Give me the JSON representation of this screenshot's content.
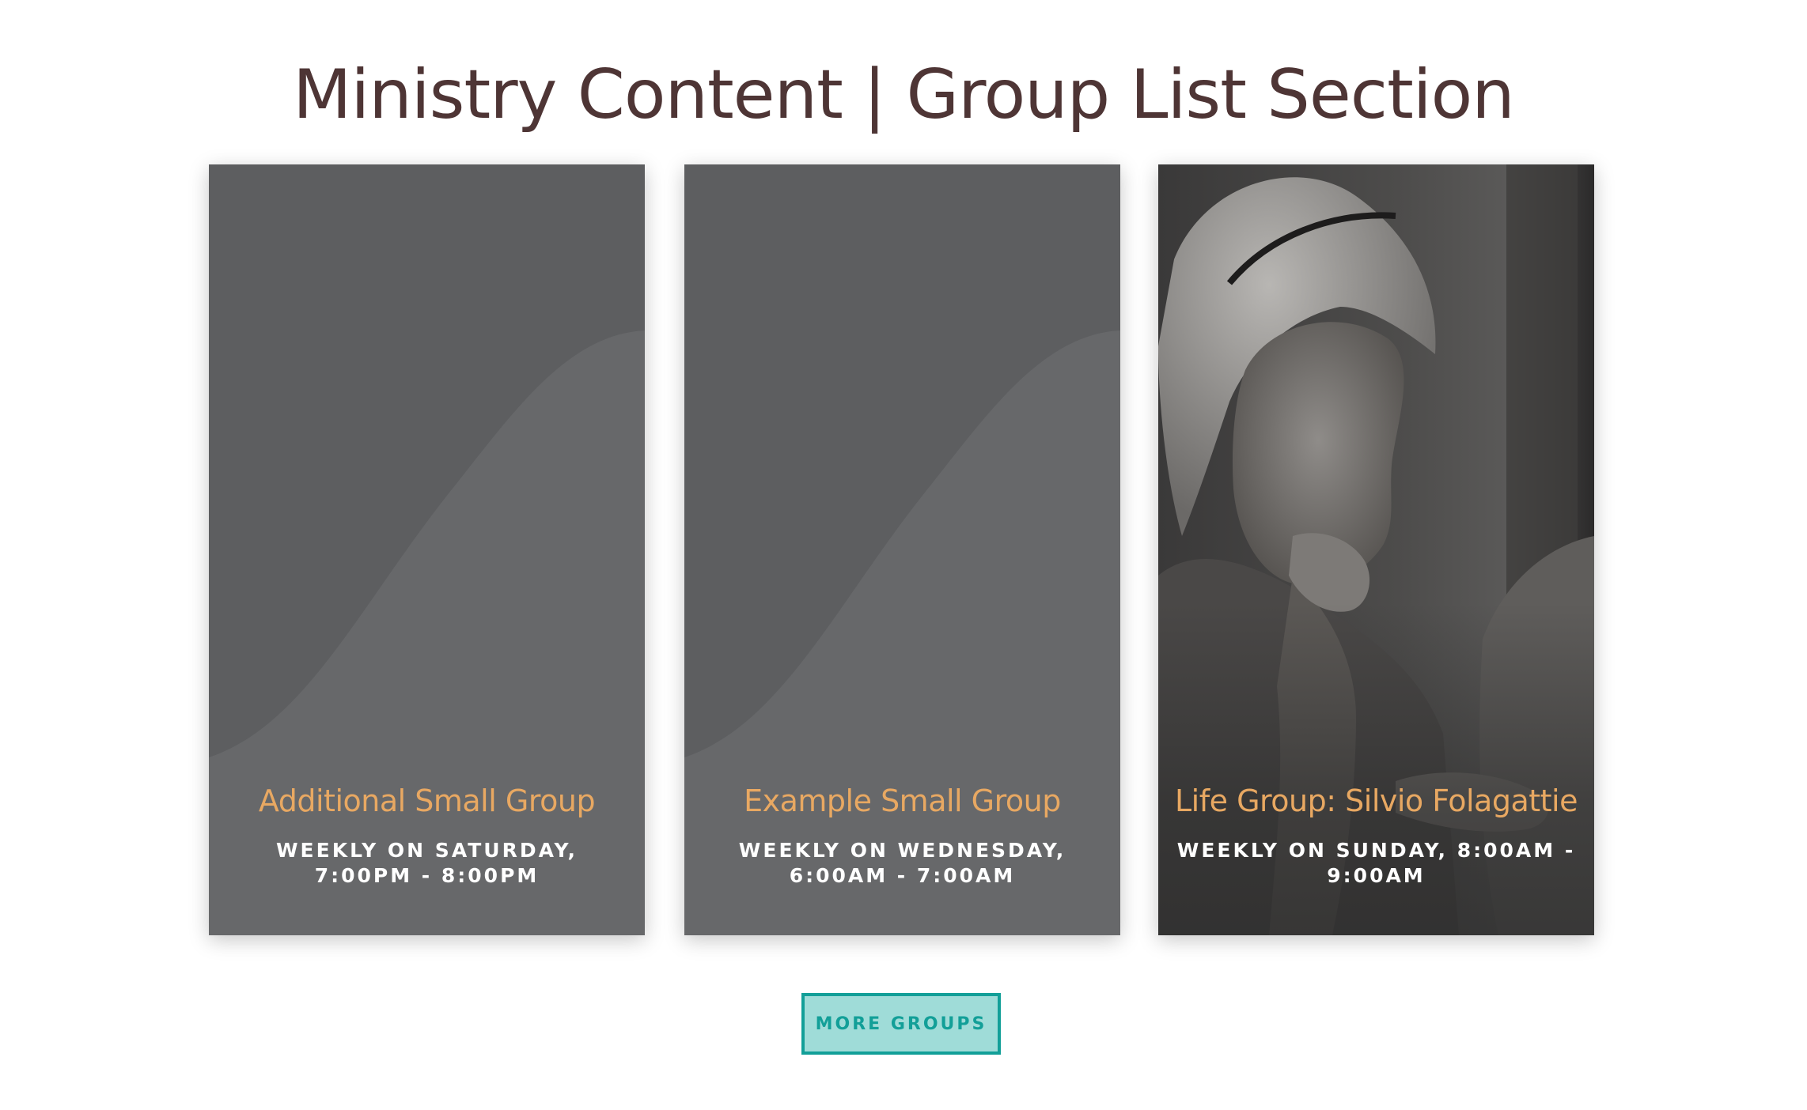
{
  "section": {
    "title": "Ministry Content | Group List Section"
  },
  "groups": [
    {
      "name": "Additional Small Group",
      "schedule": "Weekly on Saturday, 7:00pm - 8:00pm",
      "has_photo": false
    },
    {
      "name": "Example Small Group",
      "schedule": "Weekly on Wednesday, 6:00am - 7:00am",
      "has_photo": false
    },
    {
      "name": "Life Group: Silvio Folagattie",
      "schedule": "Weekly on Sunday, 8:00am - 9:00am",
      "has_photo": true
    }
  ],
  "more_button": {
    "label": "More Groups"
  },
  "colors": {
    "title": "#4e3535",
    "group_name": "#e8a862",
    "card_bg": "#5d5e60",
    "card_wave": "#67686a",
    "button_border": "#129f98",
    "button_bg": "#9fdcd8"
  }
}
